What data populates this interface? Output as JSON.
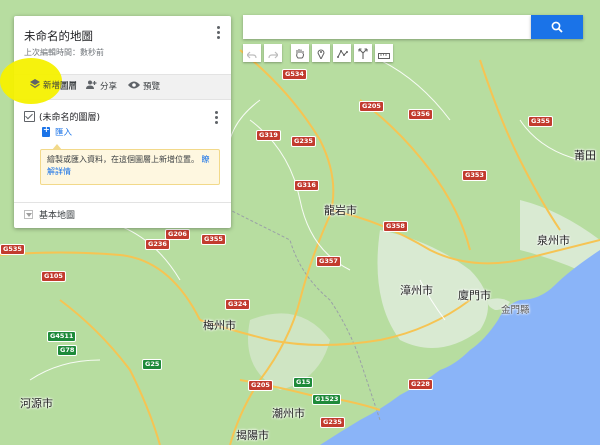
{
  "panel": {
    "title": "未命名的地圖",
    "subtitle": "上次編輯時間：數秒前",
    "add_layer_label": "新增圖層",
    "share_label": "分享",
    "preview_label": "預覽",
    "layer_name": "(未命名的圖層)",
    "import_label": "匯入",
    "tooltip_text": "繪製或匯入資料，在這個圖層上新增位置。",
    "tooltip_link": "瞭解詳情",
    "base_map_label": "基本地圖"
  },
  "search": {
    "value": "",
    "icon": "search-icon"
  },
  "tools": [
    "undo-icon",
    "redo-icon",
    "hand-icon",
    "marker-icon",
    "line-icon",
    "directions-icon",
    "ruler-icon"
  ],
  "colors": {
    "accent": "#1a73e8",
    "highlight": "#f6f100",
    "sea": "#8ab4f8",
    "land": "#b7dda0"
  },
  "map": {
    "cities": [
      "龍岩市",
      "泉州市",
      "漳州市",
      "廈門市",
      "金門縣",
      "梅州市",
      "潮州市",
      "揭陽市",
      "河源市",
      "莆田"
    ],
    "roads": [
      "G534",
      "G205",
      "G356",
      "G319",
      "G235",
      "G355",
      "G316",
      "G353",
      "G358",
      "G206",
      "G236",
      "G355",
      "G535",
      "G357",
      "G105",
      "G324",
      "G4511",
      "G78",
      "G25",
      "G1523",
      "G228",
      "G15",
      "G205",
      "G235"
    ]
  }
}
